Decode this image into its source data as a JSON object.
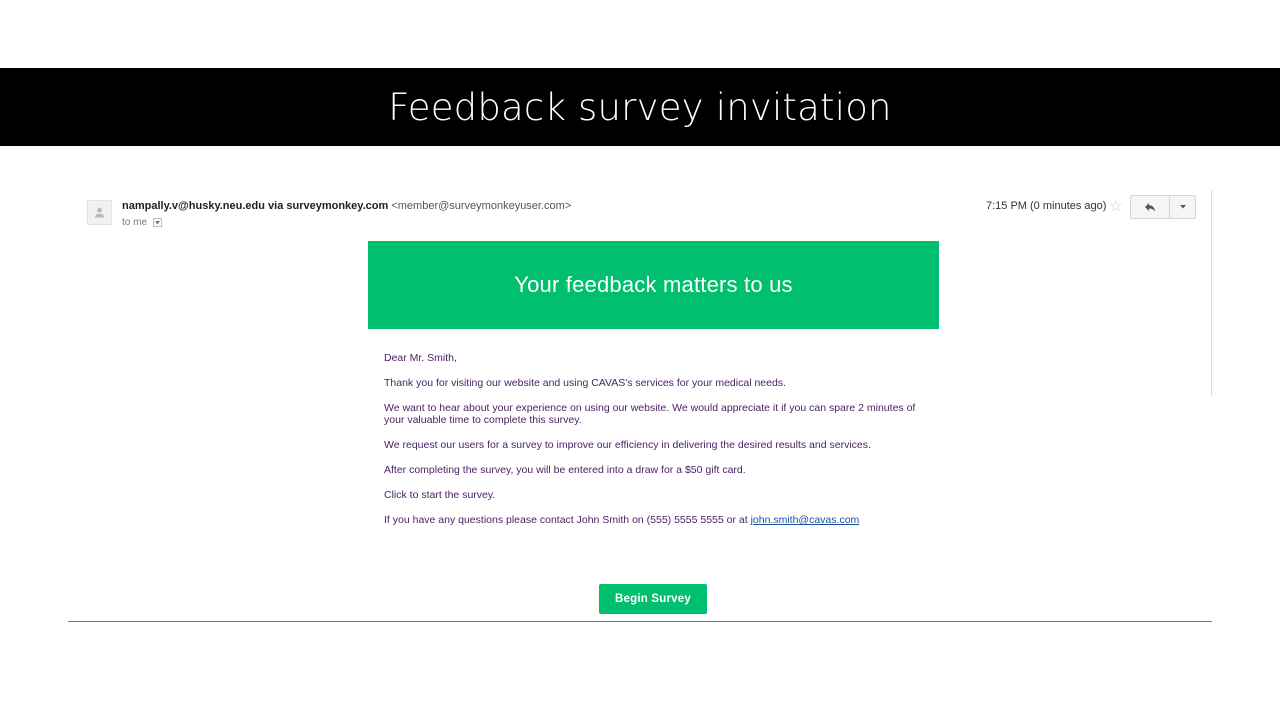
{
  "slide": {
    "title": "Feedback survey invitation"
  },
  "email": {
    "sender_name": "nampally.v@husky.neu.edu via surveymonkey.com",
    "sender_address": "<member@surveymonkeyuser.com>",
    "to": "to me",
    "timestamp": "7:15 PM (0 minutes ago)",
    "icons": [
      "person-icon",
      "star-icon",
      "reply-icon",
      "chevron-down-icon"
    ]
  },
  "message": {
    "header": "Your feedback matters to us",
    "greeting": "Dear Mr. Smith,",
    "paragraph_1": "Thank you for visiting our website and using CAVAS's services for your medical needs.",
    "paragraph_2": "We want to hear about your experience on using our website. We would appreciate it if you can spare 2 minutes of your valuable time to complete this survey.",
    "paragraph_3": "We request our users for a survey to improve our efficiency in delivering the desired results and services.",
    "paragraph_4": "After completing the survey, you will be entered into a draw for a $50 gift card.",
    "paragraph_5": "Click to start the survey.",
    "contact_prefix": "If you have any questions please contact John Smith on (555) 5555 5555 or at ",
    "contact_email": "john.smith@cavas.com",
    "button_label": "Begin Survey"
  },
  "colors": {
    "brand_green": "#00bf6f",
    "body_text": "#4b2364",
    "link": "#1a4fa0"
  }
}
